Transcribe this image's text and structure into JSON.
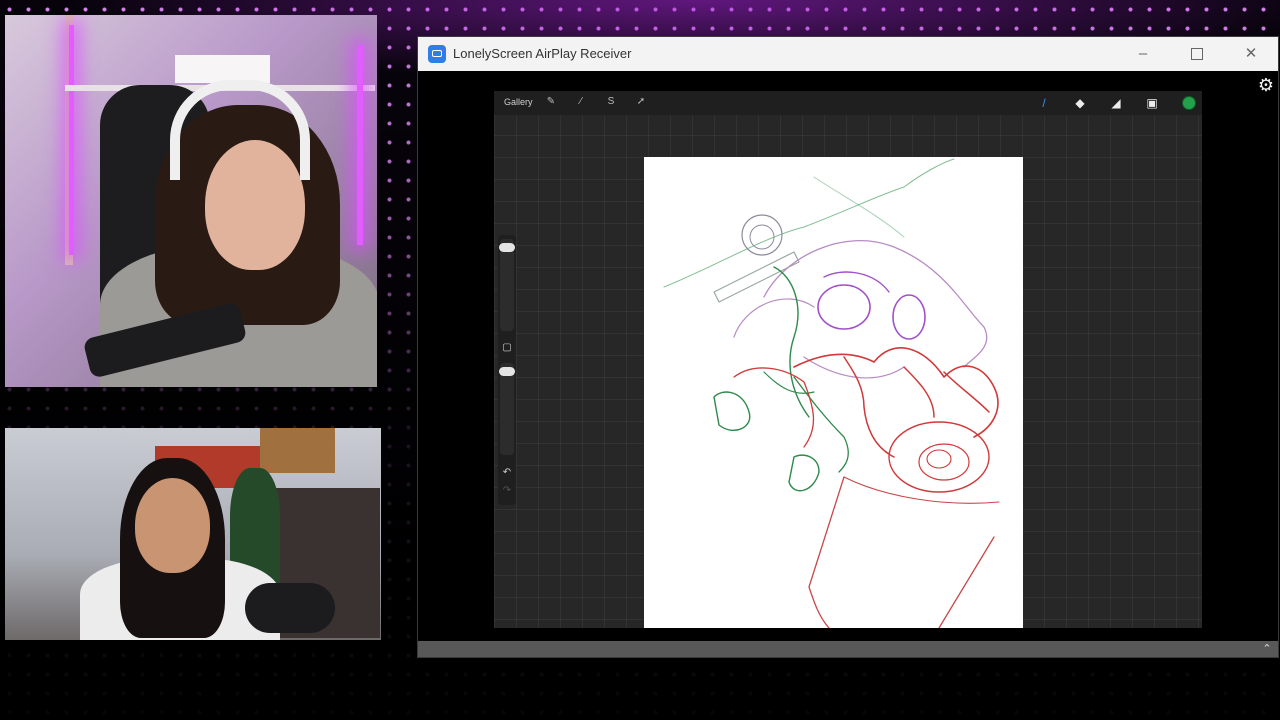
{
  "window": {
    "title": "LonelyScreen AirPlay Receiver",
    "minimize": "–",
    "close": "✕"
  },
  "procreate": {
    "gallery_label": "Gallery",
    "toolbar_icons": [
      "wrench-icon",
      "magic-wand-icon",
      "selection-icon",
      "transform-arrow-icon"
    ],
    "right_tools": [
      "brush-icon",
      "smudge-icon",
      "eraser-icon",
      "layers-icon"
    ],
    "active_color": "#22a14a"
  },
  "colors": {
    "accent": "#2f7ee6",
    "background_glow": "#c646ff",
    "sketch_red": "#d03a3a",
    "sketch_green": "#2d8a4a",
    "sketch_purple": "#a050c8"
  }
}
